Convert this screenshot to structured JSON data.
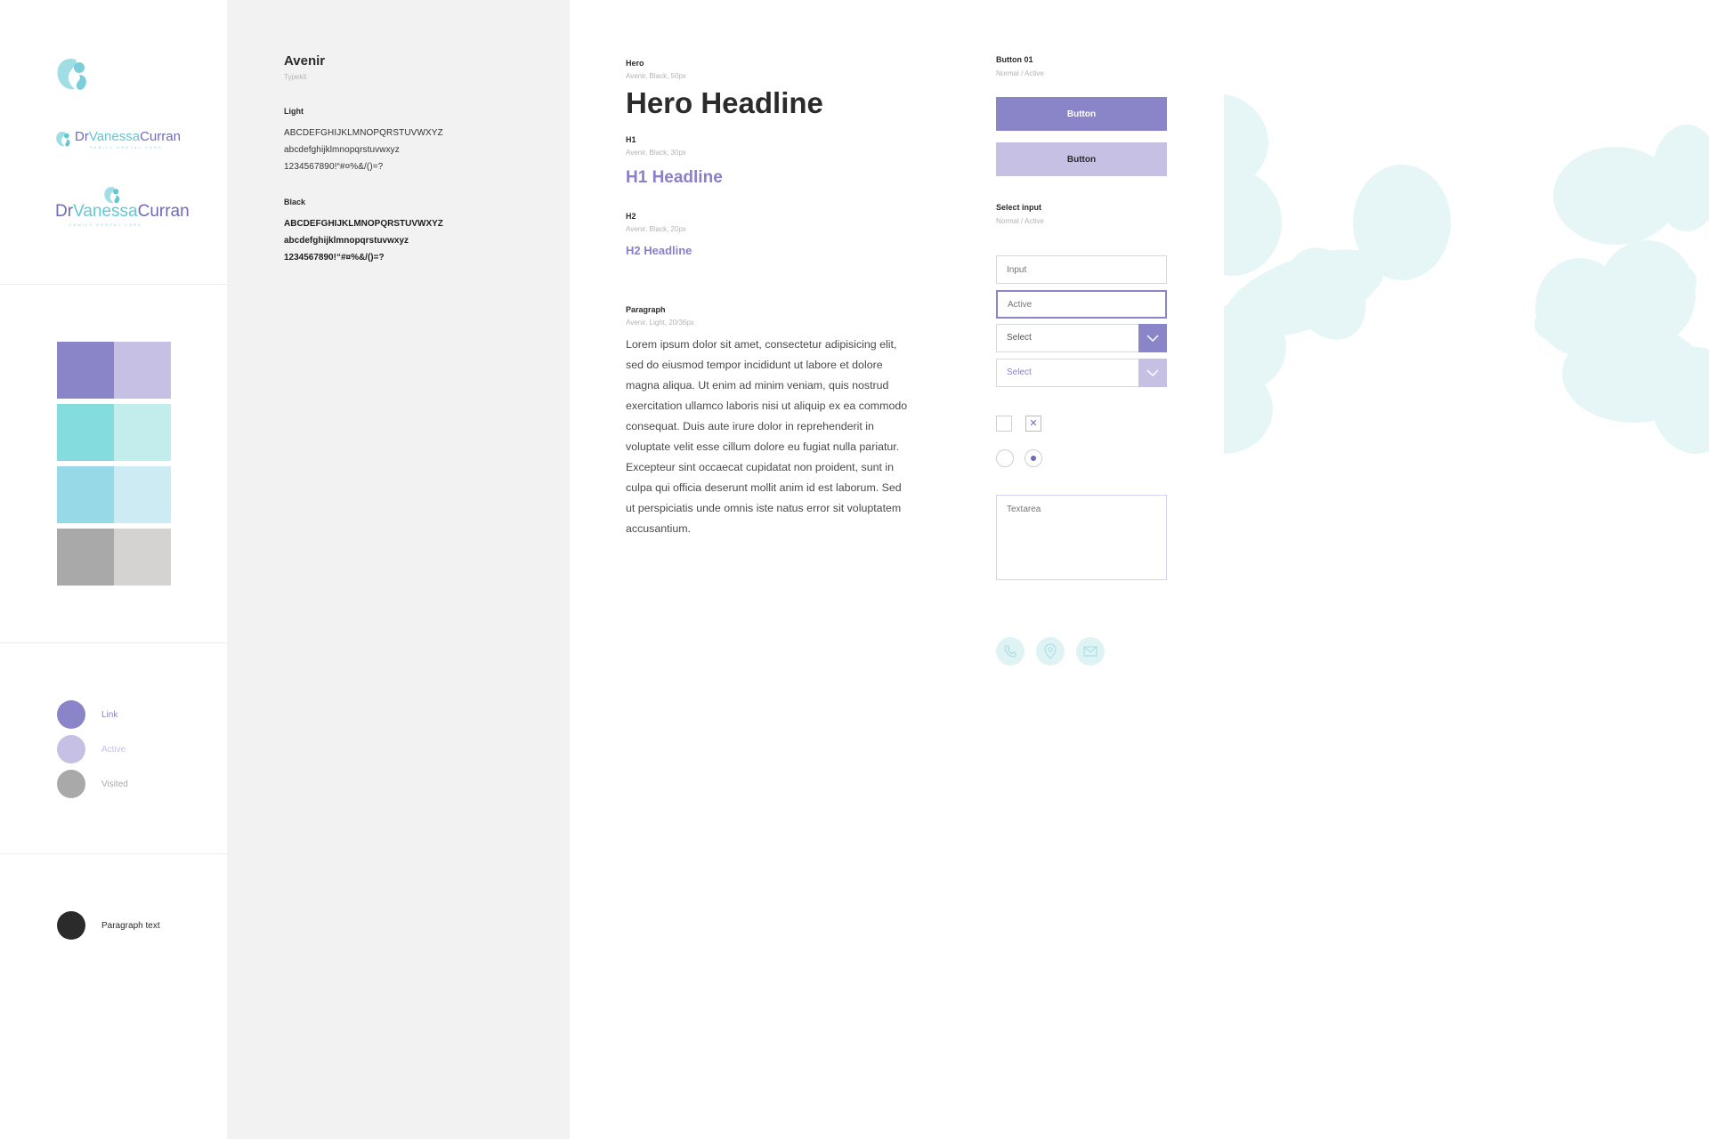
{
  "brand": {
    "logo_name_dr": "Dr",
    "logo_name_vanessa": "Vanessa",
    "logo_name_curran": "Curran",
    "logo_tagline": "FAMILY DENTAL CARE",
    "palette": [
      "#8a84c9",
      "#c6c0e5",
      "#84dcdf",
      "#c3ecec",
      "#98d9e8",
      "#cdebf3",
      "#a9a9a9",
      "#d4d3d2"
    ],
    "link_states": [
      {
        "label": "Link",
        "color": "#8a84c9",
        "text_color": "#8a84c9"
      },
      {
        "label": "Active",
        "color": "#c6c0e5",
        "text_color": "#c6c0e5"
      },
      {
        "label": "Visited",
        "color": "#a9a9a9",
        "text_color": "#a9a9a9"
      }
    ],
    "paragraph_swatch": {
      "label": "Paragraph text",
      "color": "#2b2b2b"
    }
  },
  "typography": {
    "font_name": "Avenir",
    "font_source": "Typekit",
    "light_label": "Light",
    "light_upper": "ABCDEFGHIJKLMNOPQRSTUVWXYZ",
    "light_lower": "abcdefghijklmnopqrstuvwxyz",
    "light_digits": "1234567890!“#¤%&/()=?",
    "black_label": "Black",
    "black_upper": "ABCDEFGHIJKLMNOPQRSTUVWXYZ",
    "black_lower": "abcdefghijklmnopqrstuvwxyz",
    "black_digits": "1234567890!“#¤%&/()=?"
  },
  "headings": {
    "hero_label": "Hero",
    "hero_meta": "Avenir, Black, 50px",
    "hero_text": "Hero Headline",
    "h1_label": "H1",
    "h1_meta": "Avenir, Black, 30px",
    "h1_text": "H1 Headline",
    "h2_label": "H2",
    "h2_meta": "Avenir, Black, 20px",
    "h2_text": "H2 Headline",
    "paragraph_label": "Paragraph",
    "paragraph_meta": "Avenir, Light, 20/36px",
    "paragraph_text": "Lorem ipsum dolor sit amet, consectetur adipisicing elit, sed do eiusmod tempor incididunt ut labore et dolore magna aliqua. Ut enim ad minim veniam, quis nostrud exercitation ullamco laboris nisi ut aliquip ex ea commodo consequat. Duis aute irure dolor in reprehenderit in voluptate velit esse cillum dolore eu fugiat nulla pariatur. Excepteur sint occaecat cupidatat non proident, sunt in culpa qui officia deserunt mollit anim id est laborum. Sed ut perspiciatis unde omnis iste natus error sit voluptatem accusantium."
  },
  "components": {
    "button_title": "Button 01",
    "button_meta": "Normal / Active",
    "button_normal_label": "Button",
    "button_active_label": "Button",
    "button_normal_color": "#8a84c9",
    "button_active_color": "#c6c0e5",
    "select_title": "Select input",
    "select_meta": "Normal / Active",
    "input_placeholder": "Input",
    "input_active_placeholder": "Active",
    "select_normal_label": "Select",
    "select_active_label": "Select",
    "checkbox_checked_glyph": "✕",
    "textarea_placeholder": "Textarea",
    "contact_icons": [
      "phone-icon",
      "location-pin-icon",
      "mail-icon"
    ]
  }
}
